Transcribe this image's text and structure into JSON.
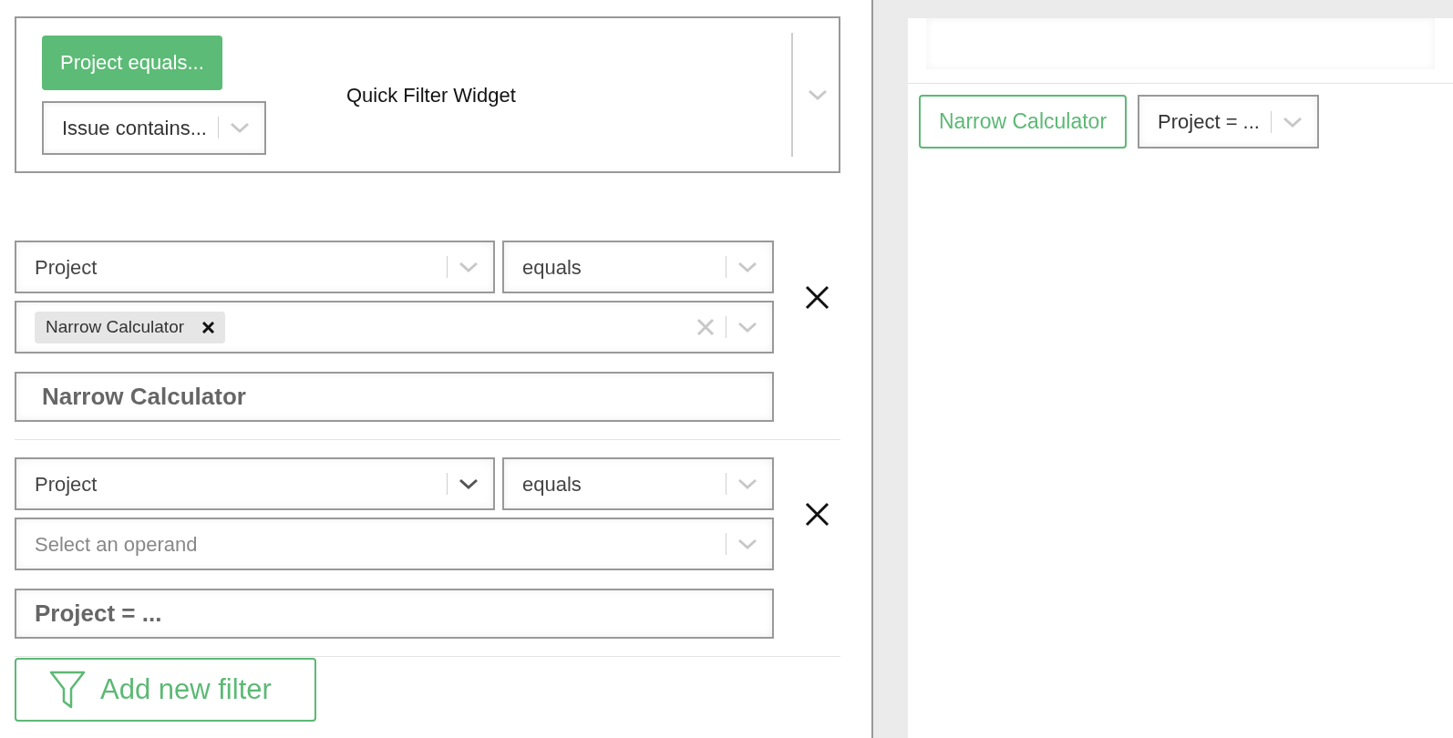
{
  "widget": {
    "title": "Quick Filter Widget",
    "items": [
      {
        "kind": "button",
        "label": "Project equals..."
      },
      {
        "kind": "dropdown",
        "label": "Issue contains..."
      }
    ]
  },
  "filters": [
    {
      "field": "Project",
      "focused": false,
      "operator": "equals",
      "operand": {
        "tags": [
          "Narrow Calculator"
        ]
      },
      "name": "Narrow Calculator"
    },
    {
      "field": "Project",
      "focused": true,
      "operator": "equals",
      "operand": {
        "placeholder": "Select an operand"
      },
      "name": "Project = ..."
    }
  ],
  "add_button": "Add new filter",
  "preview": {
    "items": [
      {
        "kind": "button",
        "label": "Narrow Calculator"
      },
      {
        "kind": "dropdown",
        "label": "Project = ..."
      }
    ]
  }
}
